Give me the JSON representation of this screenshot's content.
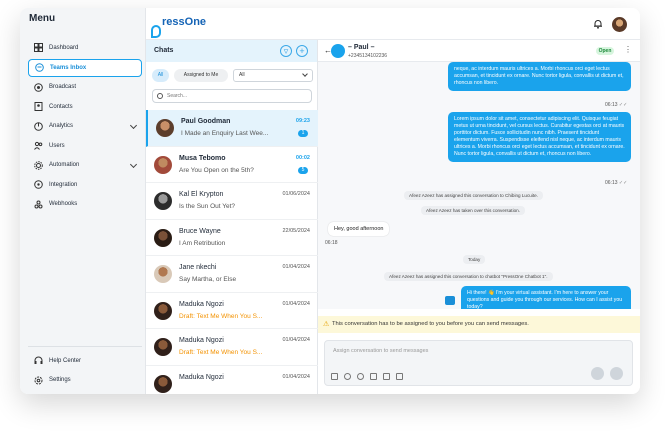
{
  "sidebar": {
    "title": "Menu",
    "items": [
      {
        "label": "Dashboard",
        "icon": "dashboard-icon"
      },
      {
        "label": "Teams Inbox",
        "icon": "chat-bubble-icon"
      },
      {
        "label": "Broadcast",
        "icon": "broadcast-icon"
      },
      {
        "label": "Contacts",
        "icon": "contacts-icon"
      },
      {
        "label": "Analytics",
        "icon": "analytics-icon"
      },
      {
        "label": "Users",
        "icon": "users-icon"
      },
      {
        "label": "Automation",
        "icon": "automation-icon"
      },
      {
        "label": "Integration",
        "icon": "integration-icon"
      },
      {
        "label": "Webhooks",
        "icon": "webhooks-icon"
      }
    ],
    "bottom": [
      {
        "label": "Help Center",
        "icon": "headset-icon"
      },
      {
        "label": "Settings",
        "icon": "gear-icon"
      }
    ]
  },
  "header": {
    "logo": "PressOne",
    "logo_p": "P",
    "logo_rest": "ressOne"
  },
  "chats": {
    "title": "Chats",
    "filter_all": "All",
    "filter_assigned": "Assigned to Me",
    "select_value": "All",
    "search_placeholder": "Search...",
    "rows": [
      {
        "name": "Paul Goodman",
        "msg": "I Made an Enquiry Last Wee...",
        "date": "09:23",
        "badge": "1"
      },
      {
        "name": "Musa Tebomo",
        "msg": "Are You Open on the 5th?",
        "date": "00:02",
        "badge": "5"
      },
      {
        "name": "Kal El Krypton",
        "msg": "Is the Sun Out Yet?",
        "date": "01/06/2024"
      },
      {
        "name": "Bruce Wayne",
        "msg": "I Am Retribution",
        "date": "22/05/2024"
      },
      {
        "name": "Jane nkechi",
        "msg": "Say Martha, or Else",
        "date": "01/04/2024"
      },
      {
        "name": "Maduka Ngozi",
        "msg": "Draft: Text Me When You S...",
        "date": "01/04/2024"
      },
      {
        "name": "Maduka Ngozi",
        "msg": "Draft: Text Me When You S...",
        "date": "01/04/2024"
      },
      {
        "name": "Maduka Ngozi",
        "msg": "",
        "date": "01/04/2024"
      }
    ]
  },
  "conversation": {
    "name": "– Paul –",
    "phone": "+2345134102236",
    "status": "Open",
    "out1": "neque, ac interdum mauris ultrices a. Morbi rhoncus orci eget lectus accumsan, et tincidunt ex ornare. Nunc tortor ligula, convallis ut dictum et, rhoncus non libero.",
    "out1_time": "06:13",
    "out2": "Lorem ipsum dolor sit amet, consectetur adipiscing elit. Quisque feugiat metus ut urna tincidunt, vel cursus lectus. Curabitur egestas orci at mauris porttitor dictum. Fusce sollicitudin nunc nibh. Praesent tincidunt elementum viverra. Suspendisse eleifend nisl neque, ac interdum mauris ultrices a. Morbi rhoncus orci eget lectus accumsan, et tincidunt ex ornare. Nunc tortor ligula, convallis ut dictum et, rhoncus non libero.",
    "out2_time": "06:13",
    "sys1": "Afeez Azeez has assigned this conversation to Chibing Lucuite.",
    "sys2": "Afeez Azeez has taken over this conversation.",
    "in1": "Hey, good afternoon",
    "in1_time": "06:18",
    "day": "Today",
    "sys3": "Afeez Azeez has assigned this conversation to chatbot \"PressOne Chatbot 1\".",
    "bot": "Hi there! 👋 I'm your virtual assistant. I'm here to answer your questions and guide you through our services. How can I assist you today?",
    "warning": "This conversation has to be assigned to you before you can send messages.",
    "composer_placeholder": "Assign conversation to send messages"
  }
}
